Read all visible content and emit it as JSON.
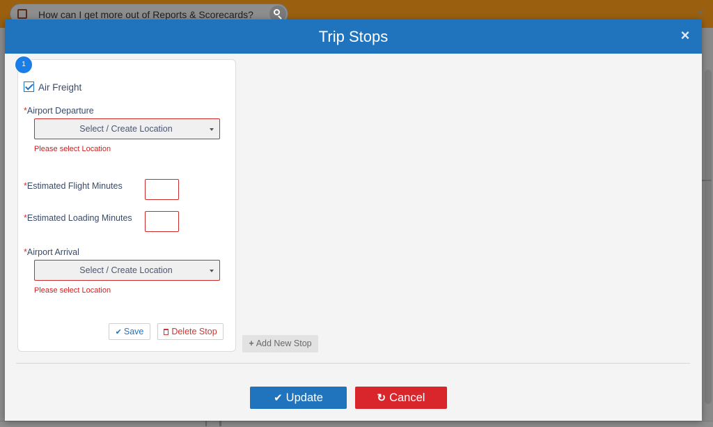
{
  "background": {
    "search_text": "How can I get more out of Reports & Scorecards?"
  },
  "modal": {
    "title": "Trip Stops",
    "close_icon": "close-icon"
  },
  "stop": {
    "number": "1",
    "air_freight_label": "Air Freight",
    "air_freight_checked": true,
    "required_mark": "*",
    "departure_label": "Airport Departure",
    "departure_placeholder": "Select / Create Location",
    "departure_error": "Please select Location",
    "flight_minutes_label": "Estimated Flight Minutes",
    "flight_minutes_value": "",
    "loading_minutes_label": "Estimated Loading Minutes",
    "loading_minutes_value": "",
    "arrival_label": "Airport Arrival",
    "arrival_placeholder": "Select / Create Location",
    "arrival_error": "Please select Location",
    "save_label": "Save",
    "delete_label": "Delete Stop"
  },
  "actions": {
    "add_stop_label": "Add New Stop",
    "update_label": "Update",
    "cancel_label": "Cancel"
  },
  "colors": {
    "header": "#1f74bd",
    "error": "#cc1f1f",
    "cancel": "#d9262c",
    "badge": "#1a7ee6"
  }
}
